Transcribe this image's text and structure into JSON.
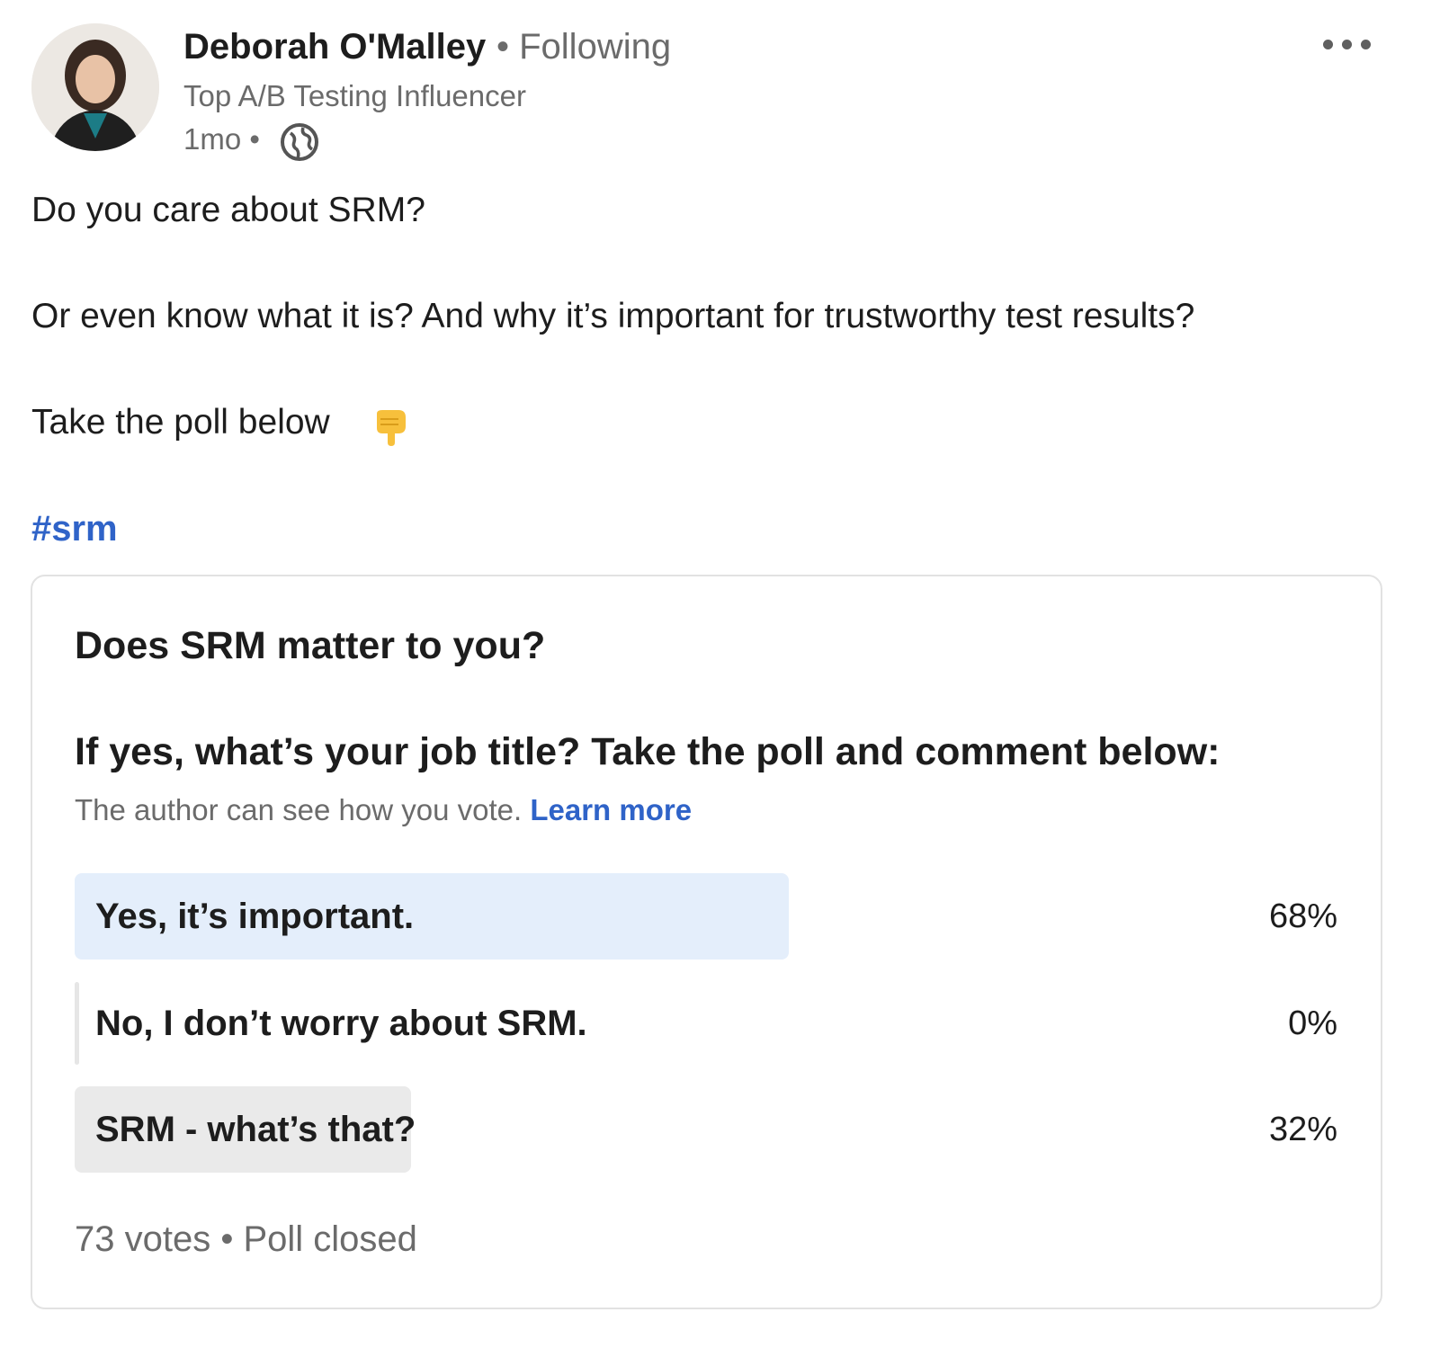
{
  "post": {
    "author": {
      "name": "Deborah O'Malley",
      "follow_status": "• Following",
      "headline": "Top A/B Testing Influencer",
      "time": "1mo •",
      "visibility_icon": "globe-icon",
      "avatar": "profile-photo"
    },
    "menu_icon": "more-options-icon",
    "body": {
      "line1": "Do you care about SRM?",
      "line2": "Or even know what it is? And why it’s important for trustworthy test results?",
      "line3": "Take the poll below",
      "emoji_icon": "pointing-down-hand-icon",
      "hashtag": "#srm"
    }
  },
  "poll": {
    "question_line1": "Does SRM matter to you?",
    "question_line2": "If yes, what’s your job title? Take the poll and comment below:",
    "notice": "The author can see how you vote.",
    "learn_more": "Learn more",
    "options": [
      {
        "label": "Yes, it’s important.",
        "percent_text": "68%",
        "percent": 68,
        "leading": true
      },
      {
        "label": "No, I don’t worry about SRM.",
        "percent_text": "0%",
        "percent": 0,
        "leading": false
      },
      {
        "label": "SRM - what’s that?",
        "percent_text": "32%",
        "percent": 32,
        "leading": false
      }
    ],
    "footer": "73 votes • Poll closed"
  },
  "colors": {
    "link": "#2f63c8",
    "leading_fill": "#e4eefb",
    "other_fill": "#eaeaea",
    "muted_text": "#6b6b6b"
  }
}
